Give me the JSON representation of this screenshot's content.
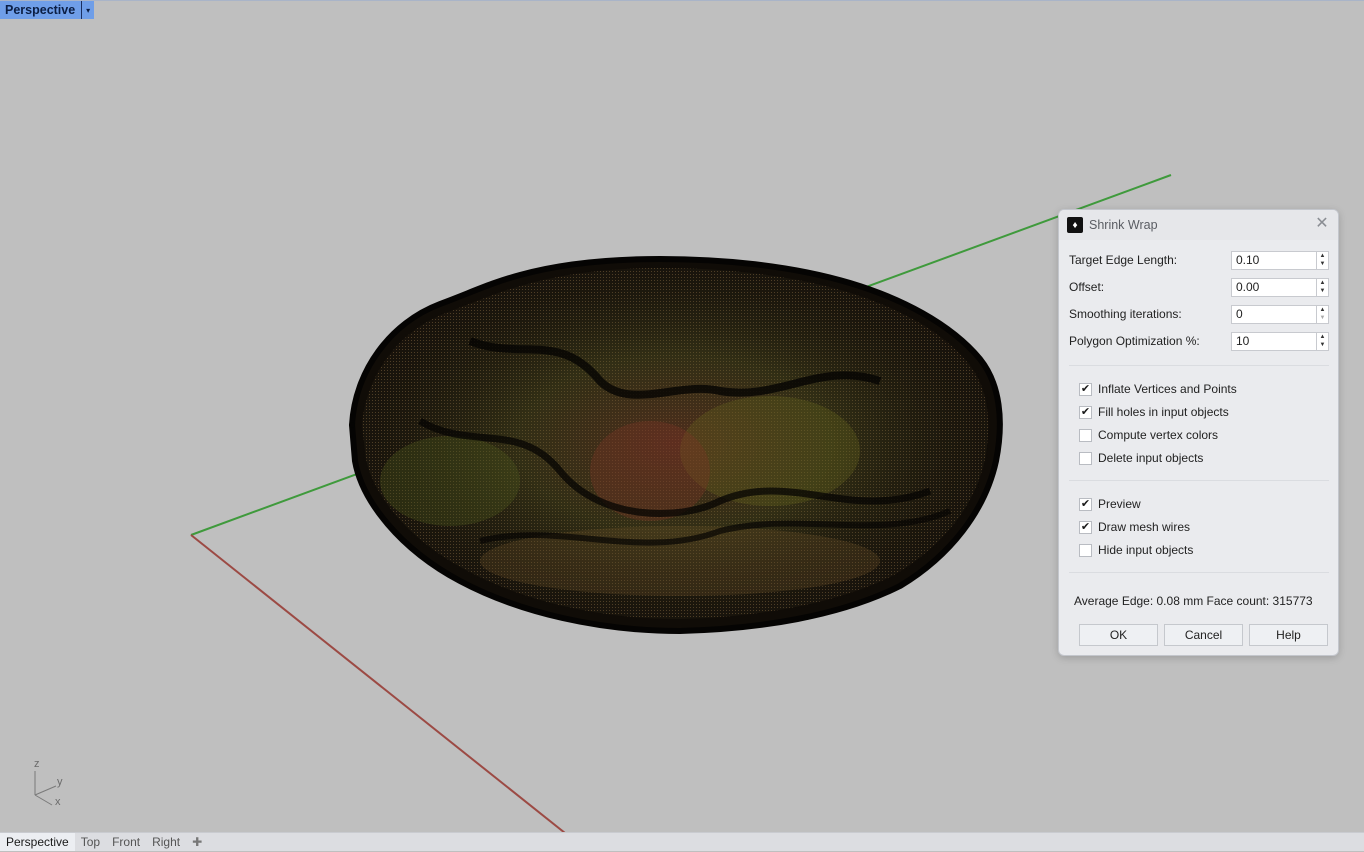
{
  "viewport": {
    "title": "Perspective",
    "dropdown_icon": "▾",
    "axis_colors": {
      "x": "#9c4a44",
      "y": "#3f9a3c"
    },
    "gumball": {
      "z": "z",
      "y": "y",
      "x": "x"
    }
  },
  "tabs": {
    "items": [
      {
        "label": "Perspective",
        "active": true
      },
      {
        "label": "Top",
        "active": false
      },
      {
        "label": "Front",
        "active": false
      },
      {
        "label": "Right",
        "active": false
      }
    ],
    "add_icon": "✚"
  },
  "dialog": {
    "title": "Shrink Wrap",
    "close_icon": "✕",
    "fields": [
      {
        "label": "Target Edge Length:",
        "value": "0.10"
      },
      {
        "label": "Offset:",
        "value": "0.00"
      },
      {
        "label": "Smoothing iterations:",
        "value": "0"
      },
      {
        "label": "Polygon Optimization %:",
        "value": "10"
      }
    ],
    "options": [
      {
        "label": "Inflate Vertices and Points",
        "checked": true
      },
      {
        "label": "Fill holes in input objects",
        "checked": true
      },
      {
        "label": "Compute vertex colors",
        "checked": false
      },
      {
        "label": "Delete input objects",
        "checked": false
      }
    ],
    "display_options": [
      {
        "label": "Preview",
        "checked": true
      },
      {
        "label": "Draw mesh wires",
        "checked": true
      },
      {
        "label": "Hide input objects",
        "checked": false
      }
    ],
    "status": "Average Edge: 0.08 mm Face count: 315773",
    "buttons": {
      "ok": "OK",
      "cancel": "Cancel",
      "help": "Help"
    }
  }
}
